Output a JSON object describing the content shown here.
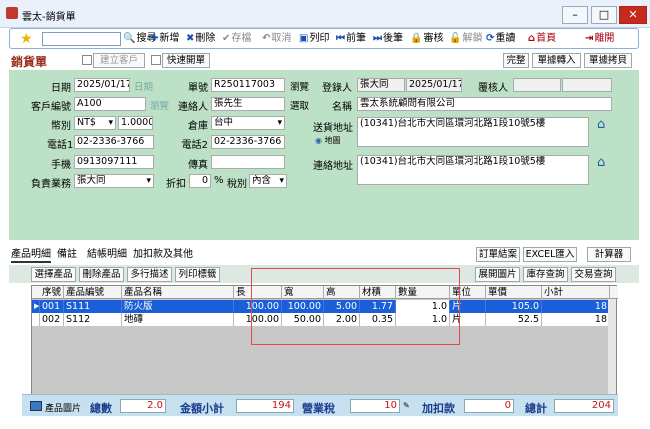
{
  "window": {
    "title": "雲太-銷貨單"
  },
  "toolbar": {
    "search_value": "",
    "search": "搜尋",
    "add": "新增",
    "delete": "刪除",
    "save": "存檔",
    "cancel": "取消",
    "print": "列印",
    "prev": "前筆",
    "next": "後筆",
    "audit": "審核",
    "unaudit": "解鎖",
    "reload": "重讀",
    "home": "首頁",
    "exit": "離開"
  },
  "header": {
    "form_title": "銷貨單",
    "new_customer": "建立客戶",
    "quick_order": "快速開單",
    "complete": "完整",
    "doc_transfer": "單據轉入",
    "doc_copy": "單據拷貝"
  },
  "form": {
    "date_label": "日期",
    "date_value": "2025/01/17",
    "date_link": "日期",
    "order_no_label": "單號",
    "order_no_value": "R250117003",
    "browse": "瀏覽",
    "registrar_label": "登錄人",
    "registrar_value": "張大同",
    "reg_date": "2025/01/17",
    "reviewer_label": "覆核人",
    "reviewer_value": "",
    "customer_no_label": "客戶編號",
    "customer_no_value": "A100",
    "customer_browse": "瀏覽",
    "contact_label": "連絡人",
    "contact_value": "張先生",
    "contact_pick": "選取",
    "name_label": "名稱",
    "name_value": "雲太系統顧問有限公司",
    "currency_label": "幣別",
    "currency_value": "NT$",
    "rate_value": "1.0000",
    "warehouse_label": "倉庫",
    "warehouse_value": "台中",
    "ship_addr_label": "送貨地址",
    "ship_addr_value": "(10341)台北市大同區環河北路1段10號5樓",
    "map": "地圖",
    "phone_label": "電話1",
    "phone_value": "02-2336-3766",
    "phone2_label": "電話2",
    "phone2_value": "02-2336-3766",
    "mobile_label": "手機",
    "mobile_value": "0913097111",
    "fax_label": "傳真",
    "fax_value": "",
    "contact_addr_label": "連絡地址",
    "contact_addr_value": "(10341)台北市大同區環河北路1段10號5樓",
    "sales_label": "負責業務",
    "sales_value": "張大同",
    "discount_label": "折扣",
    "discount_value": "0",
    "percent": "%",
    "tax_label": "稅別",
    "tax_value": "內含"
  },
  "tabs": [
    "產品明細",
    "備註",
    "結帳明細",
    "加扣款及其他"
  ],
  "tab_right": {
    "settle": "訂單結案",
    "excel": "EXCEL匯入",
    "calc": "計算器"
  },
  "detail_tools": {
    "select_product": "選擇產品",
    "delete_product": "刪除產品",
    "multi_desc": "多行描述",
    "print_label": "列印標籤",
    "expand_img": "展開圖片",
    "stock_query": "庫存查詢",
    "trade_query": "交易查詢"
  },
  "grid": {
    "columns": [
      "序號",
      "產品編號",
      "產品名稱",
      "長",
      "寬",
      "高",
      "材積",
      "數量",
      "單位",
      "單價",
      "小計"
    ],
    "rows": [
      [
        "001",
        "S111",
        "防火版",
        "100.00",
        "100.00",
        "5.00",
        "1.77",
        "1.0",
        "片",
        "105.0",
        "18"
      ],
      [
        "002",
        "S112",
        "地磚",
        "100.00",
        "50.00",
        "2.00",
        "0.35",
        "1.0",
        "片",
        "52.5",
        "18"
      ]
    ]
  },
  "footer": {
    "product_image": "產品圖片",
    "total_qty_label": "總數",
    "total_qty": "2.0",
    "subtotal_label": "金額小計",
    "subtotal": "194",
    "tax_label": "營業稅",
    "tax": "10",
    "addon_label": "加扣款",
    "addon": "0",
    "total_label": "總計",
    "total": "204"
  }
}
